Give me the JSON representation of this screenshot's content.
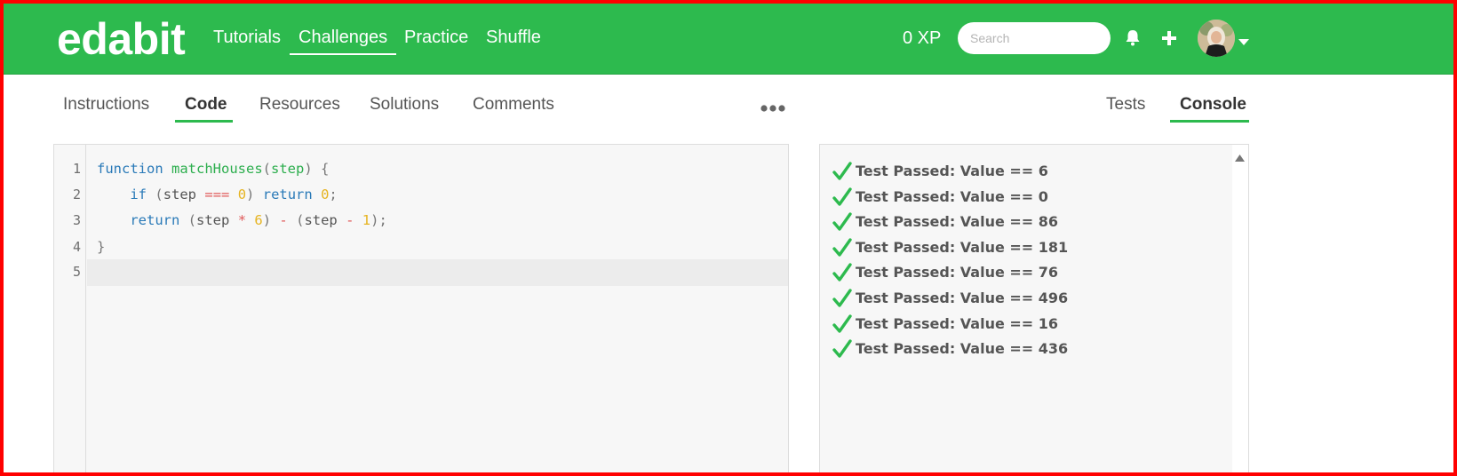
{
  "header": {
    "logo": "edabit",
    "nav": [
      {
        "label": "Tutorials"
      },
      {
        "label": "Challenges"
      },
      {
        "label": "Practice"
      },
      {
        "label": "Shuffle"
      }
    ],
    "xp": "0 XP",
    "search_placeholder": "Search",
    "icons": [
      "bell-icon",
      "plus-icon",
      "avatar",
      "caret-down-icon"
    ]
  },
  "tabs": {
    "left": [
      {
        "label": "Instructions"
      },
      {
        "label": "Code"
      },
      {
        "label": "Resources"
      },
      {
        "label": "Solutions"
      },
      {
        "label": "Comments"
      }
    ],
    "right": [
      {
        "label": "Tests"
      },
      {
        "label": "Console"
      }
    ],
    "active_left": "Code",
    "active_right": "Console"
  },
  "editor": {
    "line_numbers": [
      "1",
      "2",
      "3",
      "4",
      "5"
    ],
    "lines": [
      "function matchHouses(step) {",
      "    if (step === 0) return 0;",
      "    return (step * 6) - (step - 1);",
      "}",
      ""
    ]
  },
  "console": {
    "results": [
      "Test Passed: Value == 6",
      "Test Passed: Value == 0",
      "Test Passed: Value == 86",
      "Test Passed: Value == 181",
      "Test Passed: Value == 76",
      "Test Passed: Value == 496",
      "Test Passed: Value == 16",
      "Test Passed: Value == 436"
    ]
  },
  "colors": {
    "brand": "#2dba4e",
    "pass": "#2dba4e",
    "keyword": "#2a7ab8",
    "function": "#2dae4e",
    "operator": "#e05a5a",
    "number": "#e6b422"
  }
}
